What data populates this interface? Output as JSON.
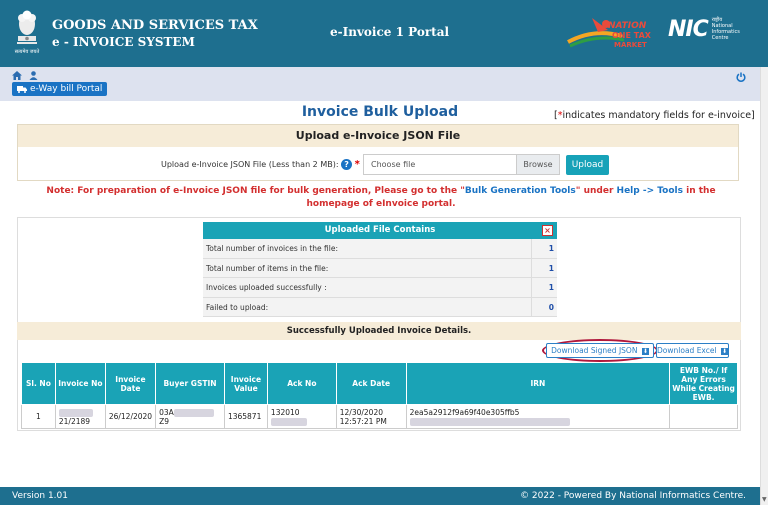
{
  "header": {
    "brand_line1": "GOODS AND SERVICES TAX",
    "brand_line2": "e - INVOICE SYSTEM",
    "emblem_motto": "सत्यमेव जयते",
    "portal_title": "e-Invoice 1 Portal",
    "gst_logo_text": "GOODS AND SERVICES TAX",
    "nic_logo": "NIC",
    "nic_sub1": "राष्ट्रीय",
    "nic_sub2": "National",
    "nic_sub3": "Informatics",
    "nic_sub4": "Centre"
  },
  "toolbar": {
    "ewb_label": "e-Way bill Portal",
    "icons": [
      "home-icon",
      "user-icon",
      "power-icon"
    ]
  },
  "main": {
    "page_title": "Invoice Bulk Upload",
    "mandatory_prefix": "[",
    "mandatory_star": "*",
    "mandatory_text": "indicates mandatory fields for e-invoice]",
    "upload_header": "Upload e-Invoice JSON File",
    "upload_label": "Upload e-Invoice JSON File (Less than 2 MB):",
    "file_placeholder": "Choose file",
    "browse_label": "Browse",
    "upload_button": "Upload",
    "note_part1": "Note: For preparation of e-Invoice JSON file for bulk generation, Please go to the \"",
    "note_link1": "Bulk Generation Tools",
    "note_part2": "\" under ",
    "note_link2": "Help -> Tools",
    "note_part3": " in the homepage of eInvoice portal."
  },
  "summary": {
    "title": "Uploaded File Contains",
    "rows": [
      {
        "label": "Total number of invoices in the file:",
        "value": "1"
      },
      {
        "label": "Total number of items in the file:",
        "value": "1"
      },
      {
        "label": "Invoices uploaded successfully :",
        "value": "1"
      },
      {
        "label": "Failed to upload:",
        "value": "0"
      }
    ]
  },
  "details": {
    "title": "Successfully Uploaded Invoice Details.",
    "download_json": "Download Signed JSON",
    "download_excel": "Download Excel",
    "columns": [
      "Sl. No",
      "Invoice No",
      "Invoice Date",
      "Buyer GSTIN",
      "Invoice Value",
      "Ack No",
      "Ack Date",
      "IRN",
      "EWB No./ If Any Errors While Creating EWB."
    ],
    "rows": [
      {
        "sl": "1",
        "invoice_no": "21/2189",
        "invoice_date": "26/12/2020",
        "buyer_gstin_prefix": "03A",
        "buyer_gstin_suffix": "Z9",
        "invoice_value": "1365871",
        "ack_no": "132010",
        "ack_date_line1": "12/30/2020",
        "ack_date_line2": "12:57:21 PM",
        "irn": "2ea5a2912f9a69f40e305ffb5",
        "ewb": ""
      }
    ]
  },
  "footer": {
    "version": "Version 1.01",
    "copyright": "© 2022 - Powered By National Informatics Centre."
  },
  "colors": {
    "header_bg": "#1e6f8f",
    "toolbar_bg": "#dde2ef",
    "accent_teal": "#1aa3b6",
    "title_blue": "#1f5f9e",
    "note_red": "#d32f2f",
    "link_blue": "#1a73c4"
  }
}
